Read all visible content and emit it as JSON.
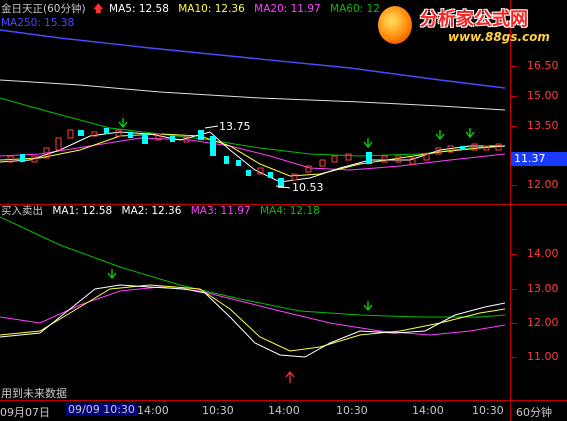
{
  "main_panel": {
    "legend": {
      "name": "金日天正(60分钟)",
      "ma5": "MA5: 12.58",
      "ma10": "MA10: 12.36",
      "ma20": "MA20: 11.97",
      "ma60": "MA60: 12",
      "ma250": "MA250: 15.38"
    },
    "y_axis_labels": [
      "16.50",
      "15.00",
      "13.50",
      "12.00"
    ],
    "current_price": "11.37",
    "annotations": {
      "high": "13.75",
      "low": "10.53"
    },
    "colors": {
      "up": "#ff4040",
      "down": "#00ffff",
      "ma5": "#ffffff",
      "ma10": "#ffff00",
      "ma20": "#ff40ff",
      "ma60": "#00c000",
      "ma250": "#4040ff"
    }
  },
  "indicator_panel": {
    "legend": {
      "name": "买入卖出",
      "ma1": "MA1: 12.58",
      "ma2": "MA2: 12.36",
      "ma3": "MA3: 11.97",
      "ma4": "MA4: 12.18"
    },
    "y_axis_labels": [
      "14.00",
      "13.00",
      "12.00",
      "11.00"
    ],
    "footer_text": "用到未来数据"
  },
  "time_axis": {
    "labels": [
      "09月07日",
      "09/09 10:30",
      "14:00",
      "10:30",
      "14:00",
      "10:30",
      "14:00",
      "10:30"
    ],
    "period_button": "60分钟"
  },
  "watermark": {
    "brand": "分析家公式网",
    "url": "www.88gs.com"
  }
}
